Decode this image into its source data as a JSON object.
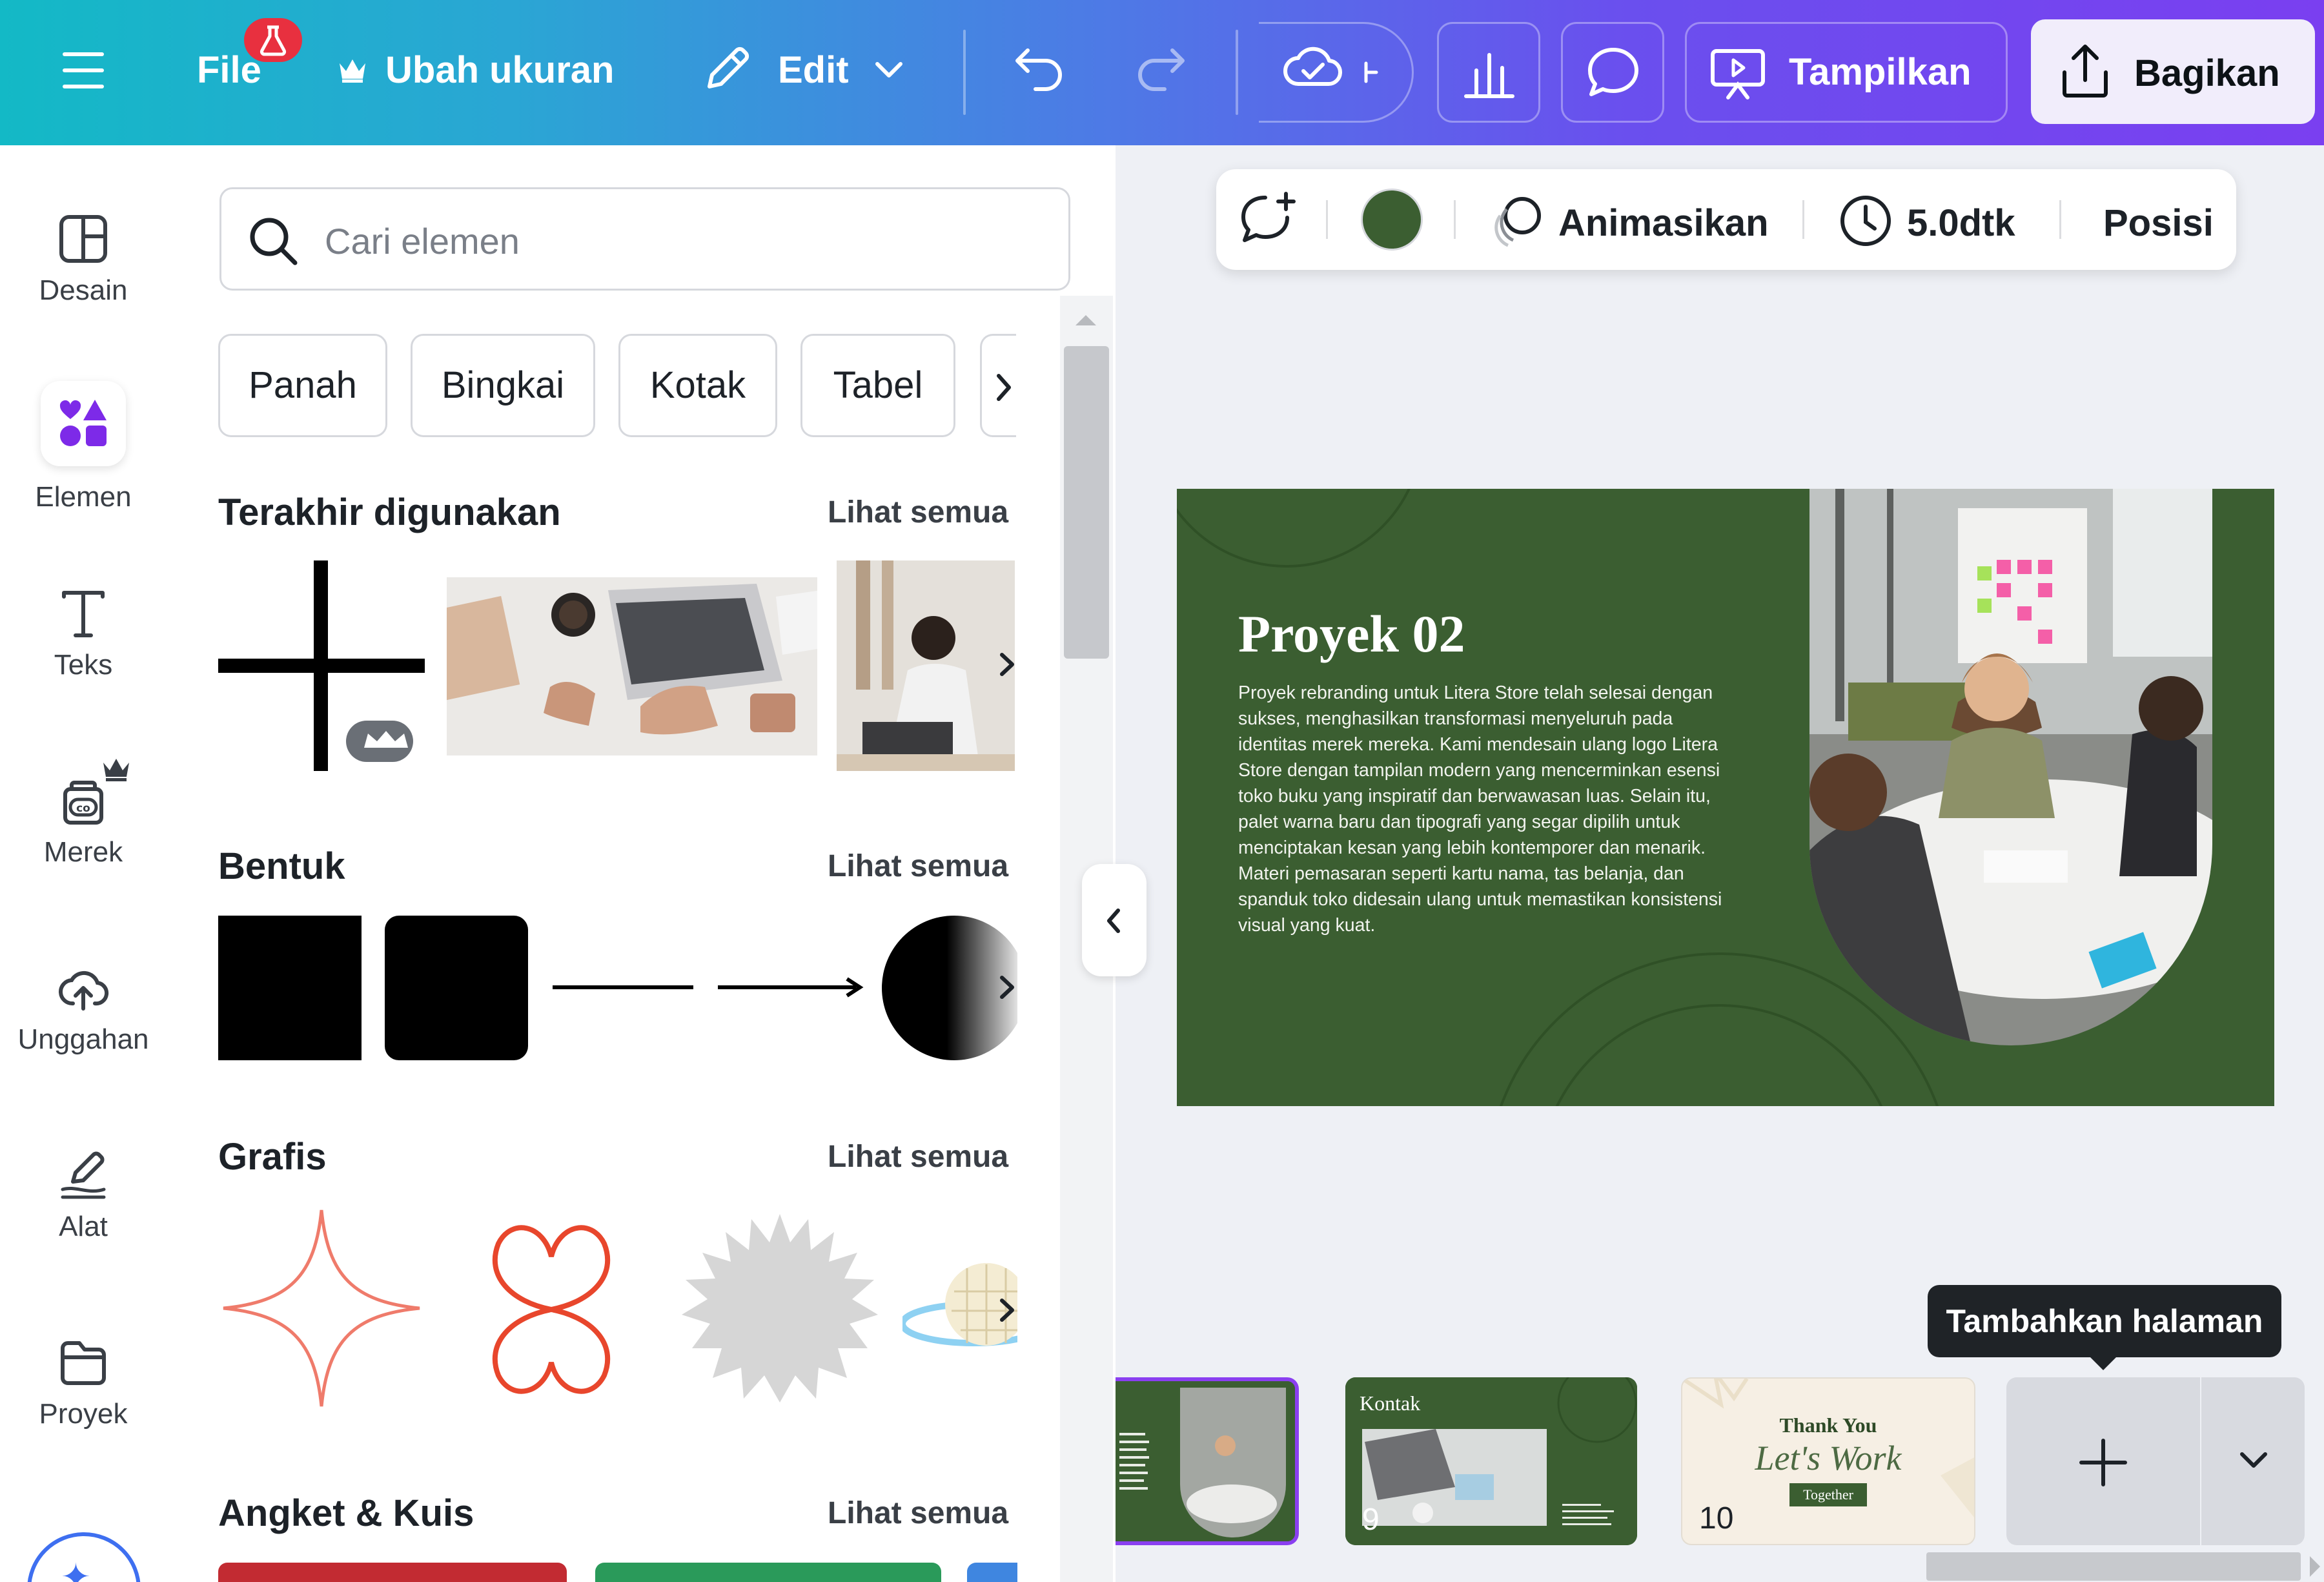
{
  "topbar": {
    "file_label": "File",
    "resize_label": "Ubah ukuran",
    "edit_label": "Edit",
    "present_label": "Tampilkan",
    "share_label": "Bagikan"
  },
  "rail": {
    "items": [
      {
        "label": "Desain"
      },
      {
        "label": "Elemen"
      },
      {
        "label": "Teks"
      },
      {
        "label": "Merek"
      },
      {
        "label": "Unggahan"
      },
      {
        "label": "Alat"
      },
      {
        "label": "Proyek"
      }
    ]
  },
  "panel": {
    "search_placeholder": "Cari elemen",
    "chips": [
      "Panah",
      "Bingkai",
      "Kotak",
      "Tabel"
    ],
    "see_all": "Lihat semua",
    "sections": {
      "recent": "Terakhir digunakan",
      "shapes": "Bentuk",
      "graphics": "Grafis",
      "polls": "Angket & Kuis"
    }
  },
  "context_toolbar": {
    "animate_label": "Animasikan",
    "duration_label": "5.0dtk",
    "position_label": "Posisi",
    "color": "#3b5e31"
  },
  "slide": {
    "title": "Proyek 02",
    "body": "Proyek rebranding untuk Litera Store telah selesai dengan sukses, menghasilkan transformasi menyeluruh pada identitas merek mereka. Kami mendesain ulang logo Litera Store dengan tampilan modern yang mencerminkan esensi toko buku yang inspiratif dan berwawasan luas. Selain itu, palet warna baru dan tipografi yang segar dipilih untuk menciptakan kesan yang lebih kontemporer dan menarik. Materi pemasaran seperti kartu nama, tas belanja, dan spanduk toko didesain ulang untuk memastikan konsistensi visual yang kuat."
  },
  "pages": {
    "thumb9_title": "Kontak",
    "thumb9_num": "9",
    "thumb10_line1": "Thank You",
    "thumb10_line2": "Let's Work",
    "thumb10_line3": "Together",
    "thumb10_num": "10",
    "tooltip": "Tambahkan halaman"
  },
  "colors": {
    "accent": "#7d2ae8",
    "slide_green": "#3b5e31",
    "badge_red": "#e8303f"
  }
}
